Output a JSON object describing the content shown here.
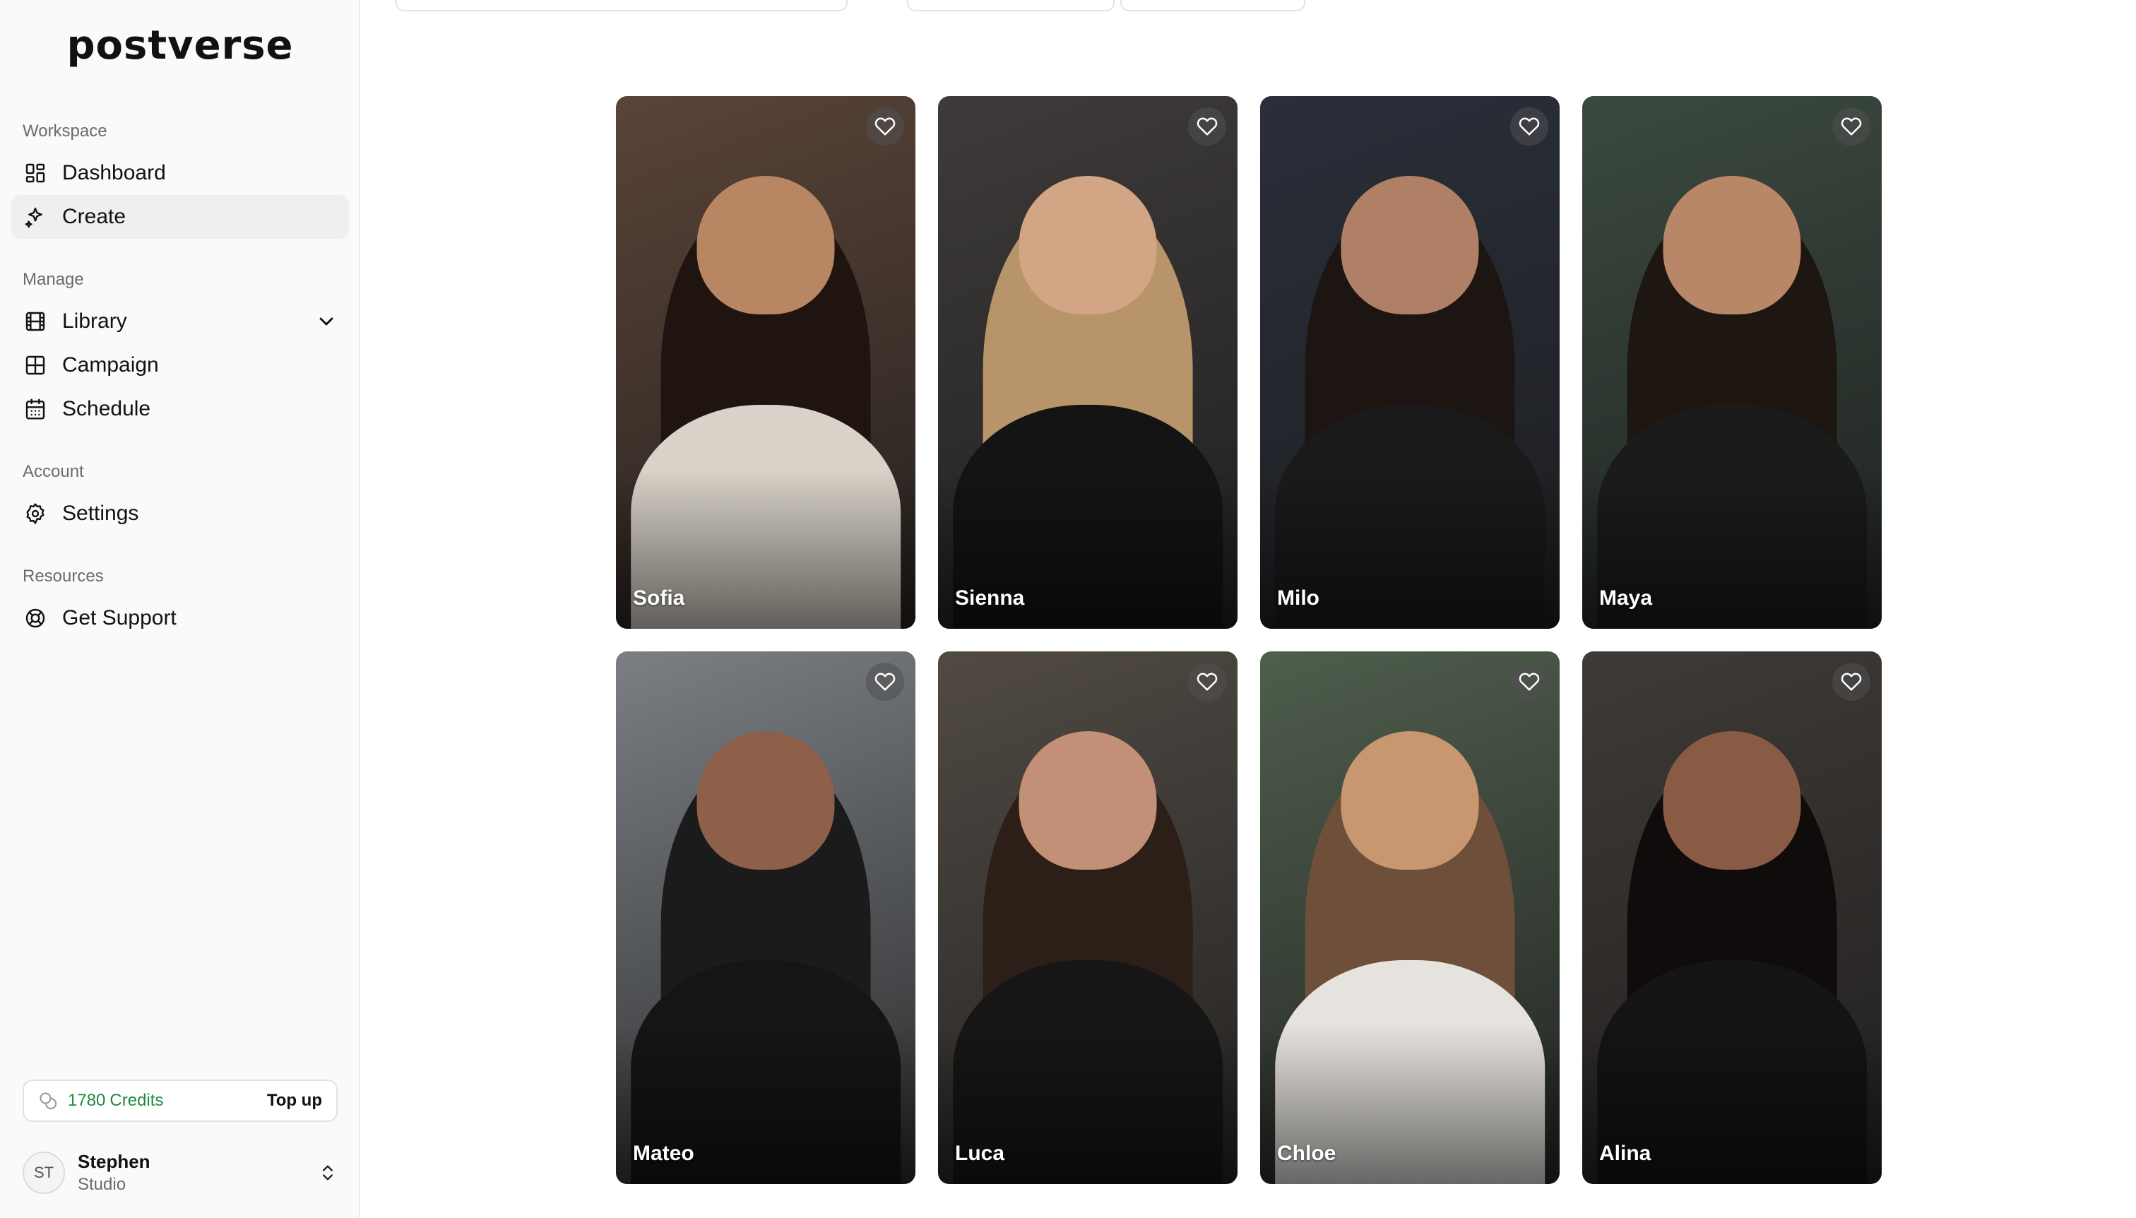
{
  "app": {
    "logo_text": "postverse"
  },
  "sidebar": {
    "sections": [
      {
        "label": "Workspace",
        "items": [
          {
            "label": "Dashboard",
            "icon": "dashboard-icon"
          },
          {
            "label": "Create",
            "icon": "sparkles-icon",
            "active": true
          }
        ]
      },
      {
        "label": "Manage",
        "items": [
          {
            "label": "Library",
            "icon": "film-icon",
            "expandable": true
          },
          {
            "label": "Campaign",
            "icon": "grid-icon"
          },
          {
            "label": "Schedule",
            "icon": "calendar-icon"
          }
        ]
      },
      {
        "label": "Account",
        "items": [
          {
            "label": "Settings",
            "icon": "gear-icon"
          }
        ]
      },
      {
        "label": "Resources",
        "items": [
          {
            "label": "Get Support",
            "icon": "lifebuoy-icon"
          }
        ]
      }
    ],
    "credits": {
      "amount": "1780",
      "label": "Credits",
      "action": "Top up"
    },
    "user": {
      "initials": "ST",
      "name": "Stephen",
      "org": "Studio"
    }
  },
  "gallery": {
    "cards": [
      {
        "name": "Sofia",
        "bg": "#5a4438",
        "hair": "#1f1410",
        "skin": "#b98663",
        "top": "#d8d2c8"
      },
      {
        "name": "Sienna",
        "bg": "#3e3a3a",
        "hair": "#b8946a",
        "skin": "#d2a585",
        "top": "#141414"
      },
      {
        "name": "Milo",
        "bg": "#2a2f3a",
        "hair": "#1c1512",
        "skin": "#b08066",
        "top": "#1a1a1a"
      },
      {
        "name": "Maya",
        "bg": "#3b4a40",
        "hair": "#1e1611",
        "skin": "#b88768",
        "top": "#1b1b1b"
      },
      {
        "name": "Mateo",
        "bg": "#7b7f84",
        "hair": "#1b1b1b",
        "skin": "#8f6049",
        "top": "#151515"
      },
      {
        "name": "Luca",
        "bg": "#514a44",
        "hair": "#2b1f18",
        "skin": "#c29077",
        "top": "#161616"
      },
      {
        "name": "Chloe",
        "bg": "#4f5e4d",
        "hair": "#6d4f3a",
        "skin": "#c8976f",
        "top": "#e6e3df"
      },
      {
        "name": "Alina",
        "bg": "#3f3a37",
        "hair": "#0f0c0b",
        "skin": "#8a5b44",
        "top": "#141414"
      }
    ]
  }
}
